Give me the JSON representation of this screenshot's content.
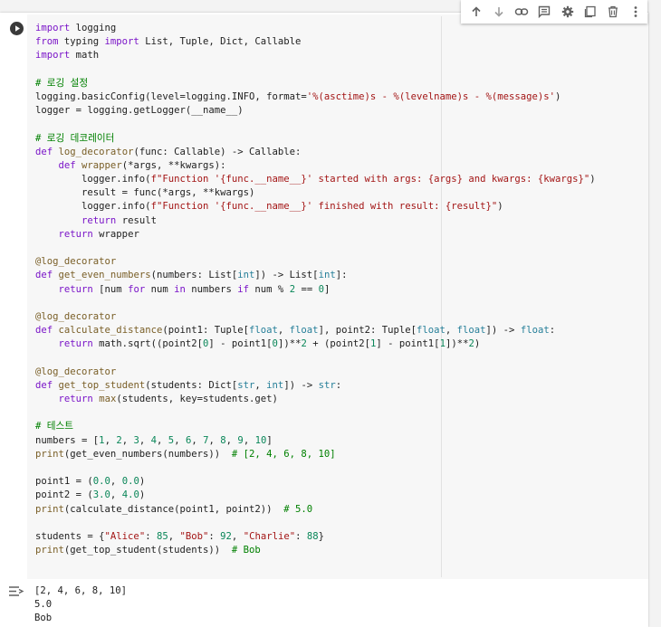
{
  "toolbar": {
    "icons": [
      "arrow-up-icon",
      "arrow-down-icon",
      "link-icon",
      "comment-icon",
      "gear-icon",
      "mirror-cell-icon",
      "trash-icon",
      "more-vert-icon"
    ]
  },
  "colors": {
    "keyword": "#7a14c8",
    "function": "#795e26",
    "string": "#a31515",
    "number": "#098658",
    "comment": "#008000",
    "type": "#267f99"
  },
  "code_lines": [
    "import logging",
    "from typing import List, Tuple, Dict, Callable",
    "import math",
    "",
    "# 로깅 설정",
    "logging.basicConfig(level=logging.INFO, format='%(asctime)s - %(levelname)s - %(message)s')",
    "logger = logging.getLogger(__name__)",
    "",
    "# 로깅 데코레이터",
    "def log_decorator(func: Callable) -> Callable:",
    "    def wrapper(*args, **kwargs):",
    "        logger.info(f\"Function '{func.__name__}' started with args: {args} and kwargs: {kwargs}\")",
    "        result = func(*args, **kwargs)",
    "        logger.info(f\"Function '{func.__name__}' finished with result: {result}\")",
    "        return result",
    "    return wrapper",
    "",
    "@log_decorator",
    "def get_even_numbers(numbers: List[int]) -> List[int]:",
    "    return [num for num in numbers if num % 2 == 0]",
    "",
    "@log_decorator",
    "def calculate_distance(point1: Tuple[float, float], point2: Tuple[float, float]) -> float:",
    "    return math.sqrt((point2[0] - point1[0])**2 + (point2[1] - point1[1])**2)",
    "",
    "@log_decorator",
    "def get_top_student(students: Dict[str, int]) -> str:",
    "    return max(students, key=students.get)",
    "",
    "# 테스트",
    "numbers = [1, 2, 3, 4, 5, 6, 7, 8, 9, 10]",
    "print(get_even_numbers(numbers))  # [2, 4, 6, 8, 10]",
    "",
    "point1 = (0.0, 0.0)",
    "point2 = (3.0, 4.0)",
    "print(calculate_distance(point1, point2))  # 5.0",
    "",
    "students = {\"Alice\": 85, \"Bob\": 92, \"Charlie\": 88}",
    "print(get_top_student(students))  # Bob"
  ],
  "output_lines": [
    "[2, 4, 6, 8, 10]",
    "5.0",
    "Bob"
  ]
}
